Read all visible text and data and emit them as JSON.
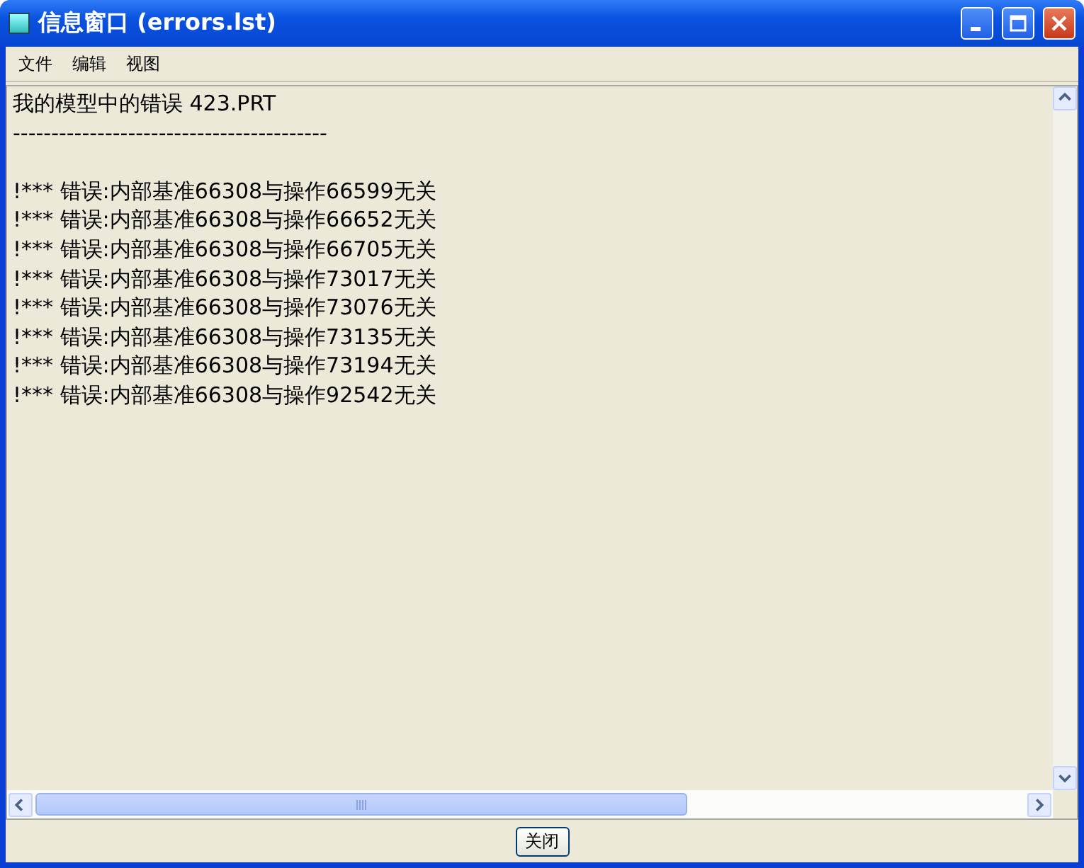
{
  "window": {
    "title": "信息窗口 (errors.lst)"
  },
  "menu": [
    {
      "label": "文件"
    },
    {
      "label": "编辑"
    },
    {
      "label": "视图"
    }
  ],
  "content": {
    "lines": [
      {
        "kind": "text",
        "text": "我的模型中的错误 423.PRT"
      },
      {
        "kind": "separator",
        "text": "-----------------------------------------"
      },
      {
        "kind": "text",
        "text": "!*** 错误:内部基准66308与操作66599无关"
      },
      {
        "kind": "text",
        "text": "!*** 错误:内部基准66308与操作66652无关"
      },
      {
        "kind": "text",
        "text": "!*** 错误:内部基准66308与操作66705无关"
      },
      {
        "kind": "text",
        "text": "!*** 错误:内部基准66308与操作73017无关"
      },
      {
        "kind": "text",
        "text": "!*** 错误:内部基准66308与操作73076无关"
      },
      {
        "kind": "text",
        "text": "!*** 错误:内部基准66308与操作73135无关"
      },
      {
        "kind": "text",
        "text": "!*** 错误:内部基准66308与操作73194无关"
      },
      {
        "kind": "text",
        "text": "!*** 错误:内部基准66308与操作92542无关"
      }
    ]
  },
  "buttons": [
    {
      "label": "关闭"
    }
  ]
}
